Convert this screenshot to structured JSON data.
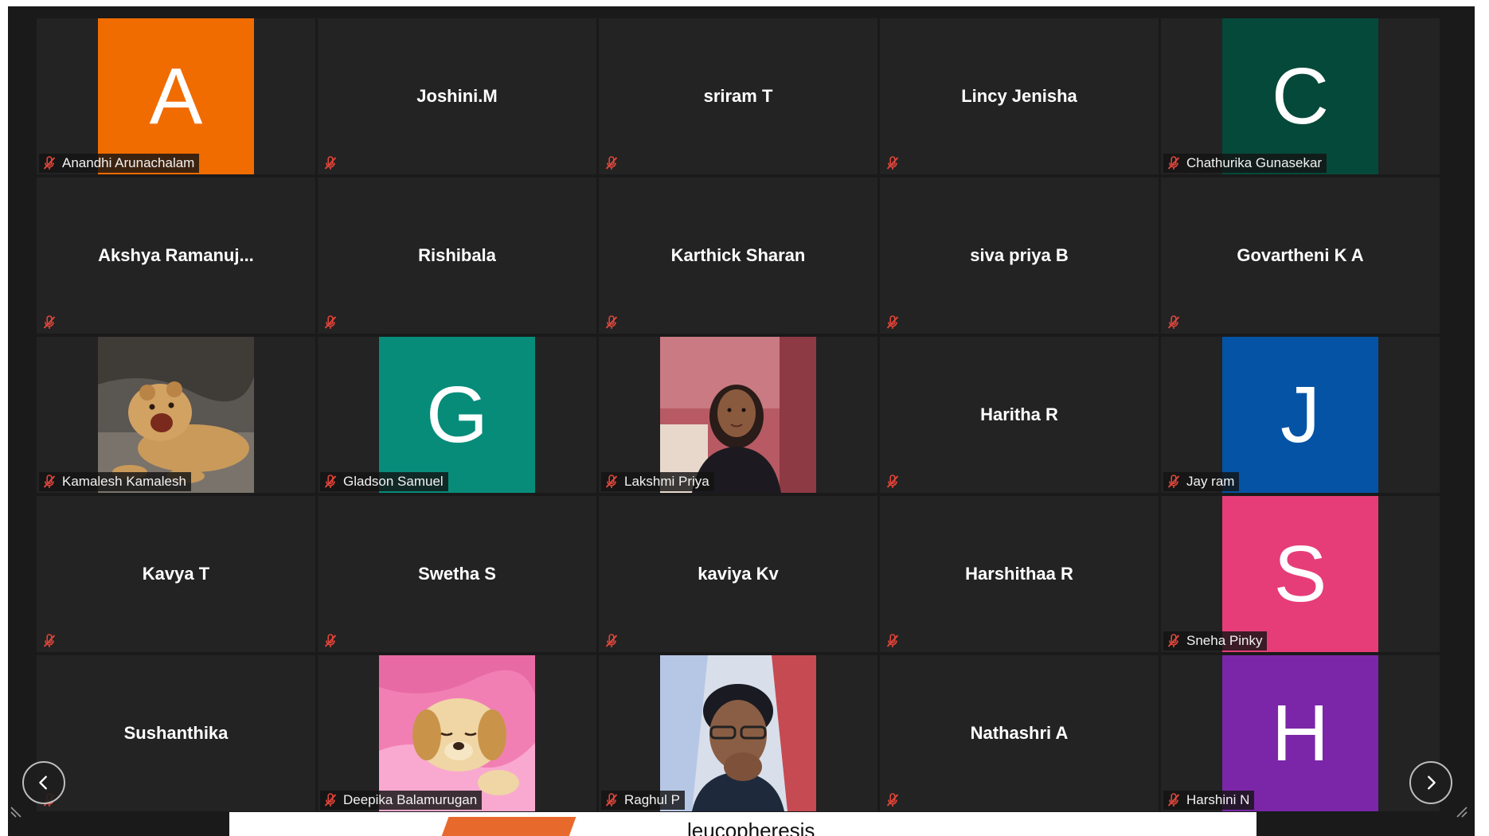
{
  "participants": [
    {
      "name": "Anandhi Arunachalam",
      "type": "avatar",
      "letter": "A",
      "color": "#F06C00",
      "show_label": true
    },
    {
      "name": "Joshini.M",
      "type": "name",
      "show_label": false
    },
    {
      "name": "sriram T",
      "type": "name",
      "show_label": false
    },
    {
      "name": "Lincy Jenisha",
      "type": "name",
      "show_label": false
    },
    {
      "name": "Chathurika Gunasekar",
      "type": "avatar",
      "letter": "C",
      "color": "#05493A",
      "show_label": true
    },
    {
      "name": "Akshya  Ramanuj...",
      "type": "name",
      "show_label": false
    },
    {
      "name": "Rishibala",
      "type": "name",
      "show_label": false
    },
    {
      "name": "Karthick Sharan",
      "type": "name",
      "show_label": false
    },
    {
      "name": "siva priya B",
      "type": "name",
      "show_label": false
    },
    {
      "name": "Govartheni K A",
      "type": "name",
      "show_label": false
    },
    {
      "name": "Kamalesh Kamalesh",
      "type": "photo",
      "photo": "lion-cub",
      "show_label": true
    },
    {
      "name": "Gladson Samuel",
      "type": "avatar",
      "letter": "G",
      "color": "#078C7A",
      "show_label": true
    },
    {
      "name": "Lakshmi Priya",
      "type": "photo",
      "photo": "woman-portrait",
      "show_label": true
    },
    {
      "name": "Haritha R",
      "type": "name",
      "show_label": false
    },
    {
      "name": "Jay ram",
      "type": "avatar",
      "letter": "J",
      "color": "#0553A5",
      "show_label": true
    },
    {
      "name": "Kavya T",
      "type": "name",
      "show_label": false
    },
    {
      "name": "Swetha S",
      "type": "name",
      "show_label": false
    },
    {
      "name": "kaviya Kv",
      "type": "name",
      "show_label": false
    },
    {
      "name": "Harshithaa R",
      "type": "name",
      "show_label": false
    },
    {
      "name": "Sneha Pinky",
      "type": "avatar",
      "letter": "S",
      "color": "#E63D78",
      "show_label": true
    },
    {
      "name": "Sushanthika",
      "type": "name",
      "show_label": false
    },
    {
      "name": "Deepika Balamurugan",
      "type": "photo",
      "photo": "puppy",
      "show_label": true
    },
    {
      "name": "Raghul P",
      "type": "photo",
      "photo": "man-portrait",
      "show_label": true
    },
    {
      "name": "Nathashri A",
      "type": "name",
      "show_label": false
    },
    {
      "name": "Harshini N",
      "type": "avatar",
      "letter": "H",
      "color": "#7B26A8",
      "show_label": true
    }
  ],
  "navigation": {
    "prev_icon": "chevron-left-icon",
    "next_icon": "chevron-right-icon"
  },
  "shared_slide": {
    "visible_text": "leucopheresis"
  },
  "colors": {
    "background": "#1a1a1a",
    "tile": "#232323",
    "mute": "#e0453a"
  }
}
